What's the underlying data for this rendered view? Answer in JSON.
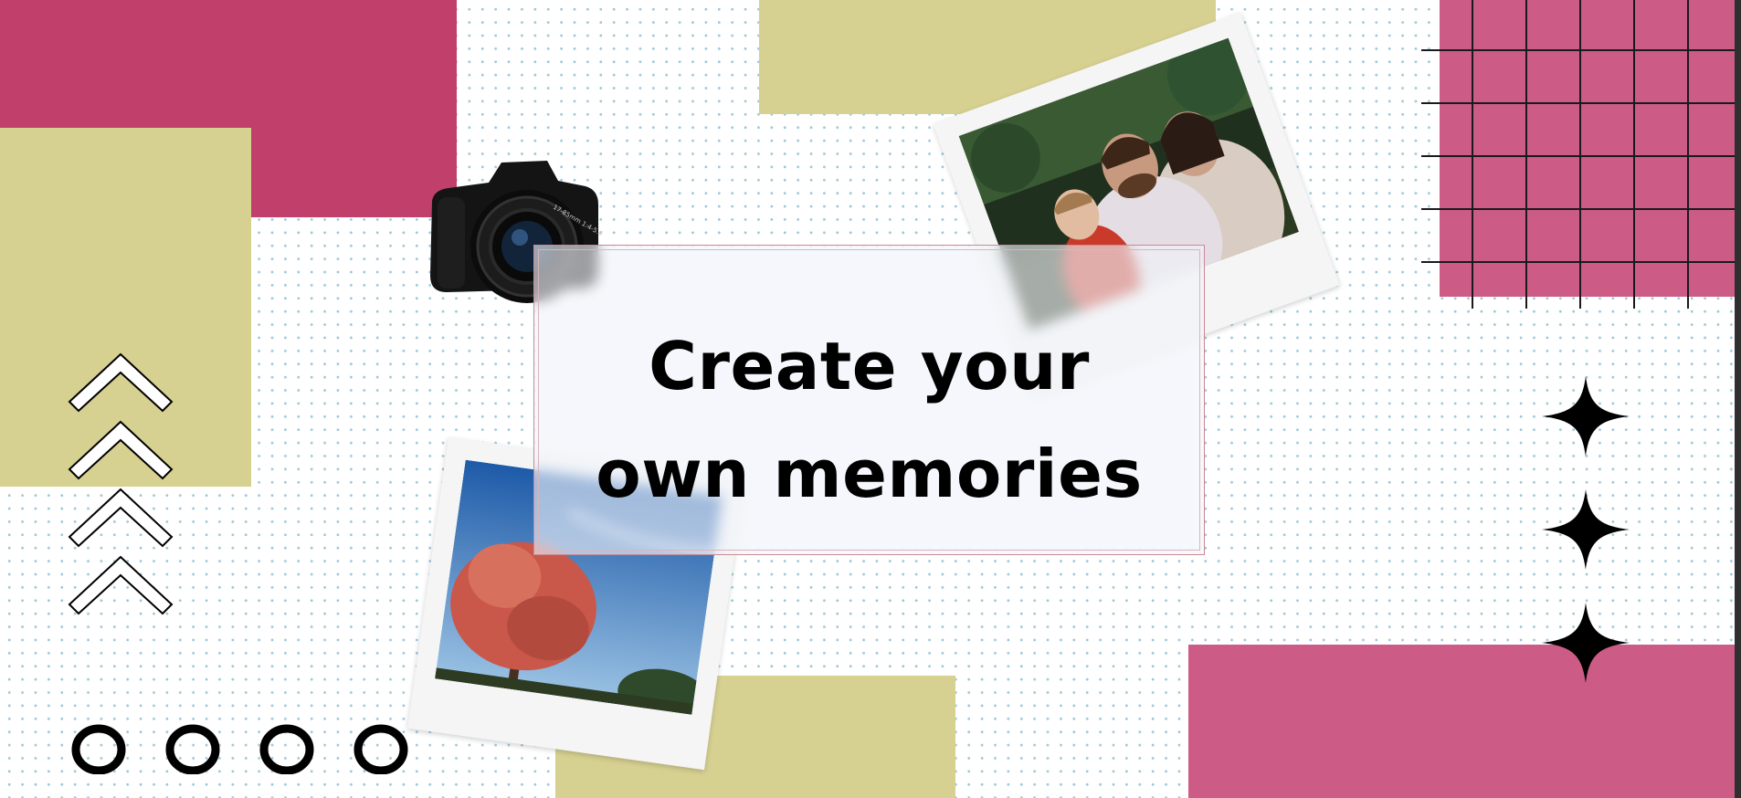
{
  "title": {
    "line1": "Create your",
    "line2": "own memories"
  },
  "camera": {
    "lens_text": "17-85mm 1:4-5.6"
  },
  "colors": {
    "pink": "#c1406b",
    "pink_light": "#cc5c86",
    "olive": "#d6d091",
    "dots": "#9cc7da",
    "ink": "#000000"
  },
  "icons": [
    "camera-icon",
    "chevron-up-icon",
    "circle-outline-icon",
    "sparkle-icon",
    "grid-pattern"
  ]
}
